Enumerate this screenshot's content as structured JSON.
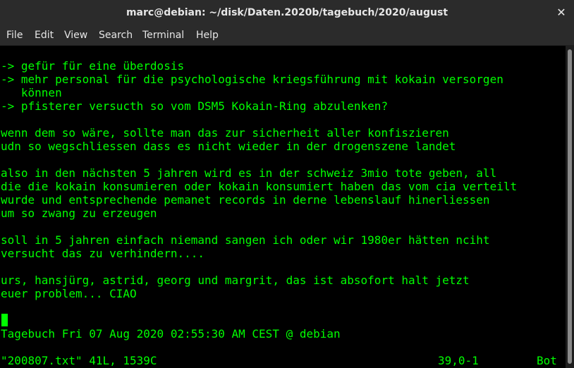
{
  "window": {
    "title": "marc@debian: ~/disk/Daten.2020b/tagebuch/2020/august",
    "close_glyph": "✕"
  },
  "menu": [
    "File",
    "Edit",
    "View",
    "Search",
    "Terminal",
    "Help"
  ],
  "terminal": {
    "text_color": "#00ff00",
    "background": "#000000",
    "lines": [
      "-> gefür für eine überdosis",
      "-> mehr personal für die psychologische kriegsführung mit kokain versorgen",
      "   können",
      "-> pfisterer versucth so vom DSM5 Kokain-Ring abzulenken?",
      "",
      "wenn dem so wäre, sollte man das zur sicherheit aller konfiszieren",
      "udn so wegschliessen dass es nicht wieder in der drogenszene landet",
      "",
      "also in den nächsten 5 jahren wird es in der schweiz 3mio tote geben, all",
      "die die kokain konsumieren oder kokain konsumiert haben das vom cia verteilt",
      "wurde und entsprechende pemanet records in derne lebenslauf hinerliessen",
      "um so zwang zu erzeugen",
      "",
      "soll in 5 jahren einfach niemand sangen ich oder wir 1980er hätten nciht",
      "versucht das zu verhindern....",
      "",
      "urs, hansjürg, astrid, georg und margrit, das ist absofort halt jetzt",
      "euer problem... CIAO"
    ],
    "footer_line": "Tagebuch Fri 07 Aug 2020 02:55:30 AM CEST @ debian",
    "status": {
      "file": "\"200807.txt\" 41L, 1539C",
      "position": "39,0-1",
      "scroll": "Bot"
    }
  }
}
